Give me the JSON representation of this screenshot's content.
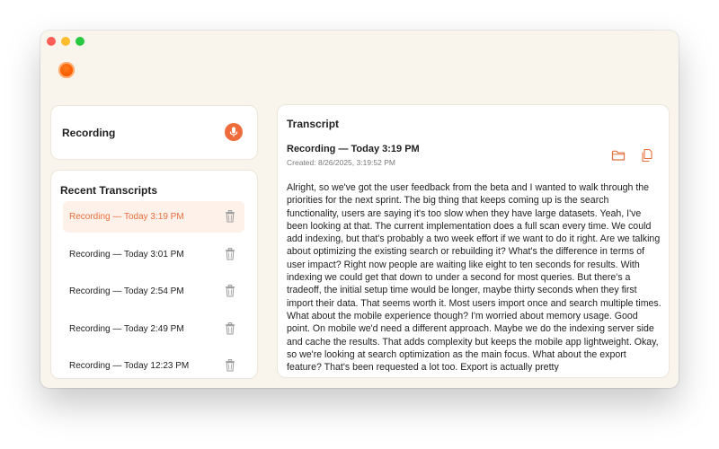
{
  "sidebar": {
    "recording_label": "Recording",
    "recent_title": "Recent Transcripts",
    "items": [
      {
        "label": "Recording — Today 3:19 PM",
        "active": true
      },
      {
        "label": "Recording — Today 3:01 PM",
        "active": false
      },
      {
        "label": "Recording — Today 2:54 PM",
        "active": false
      },
      {
        "label": "Recording — Today 2:49 PM",
        "active": false
      },
      {
        "label": "Recording — Today 12:23 PM",
        "active": false
      }
    ]
  },
  "transcript": {
    "header": "Transcript",
    "recording_title": "Recording — Today 3:19 PM",
    "created": "Created: 8/26/2025, 3:19:52 PM",
    "body": "Alright, so we've got the user feedback from the beta and I wanted to walk through the priorities for the next sprint. The big thing that keeps coming up is the search functionality, users are saying it's too slow when they have large datasets. Yeah, I've been looking at that. The current implementation does a full scan every time. We could add indexing, but that's probably a two week effort if we want to do it right. Are we talking about optimizing the existing search or rebuilding it? What's the difference in terms of user impact? Right now people are waiting like eight to ten seconds for results. With indexing we could get that down to under a second for most queries. But there's a tradeoff, the initial setup time would be longer, maybe thirty seconds when they first import their data. That seems worth it. Most users import once and search multiple times. What about the mobile experience though? I'm worried about memory usage. Good point. On mobile we'd need a different approach. Maybe we do the indexing server side and cache the results. That adds complexity but keeps the mobile app lightweight. Okay, so we're looking at search optimization as the main focus. What about the export feature? That's been requested a lot too. Export is actually pretty"
  },
  "icons": {
    "record": "microphone-icon",
    "delete": "trash-icon",
    "folder": "folder-icon",
    "copy": "copy-icon"
  },
  "colors": {
    "accent": "#e8703d",
    "window_bg": "#f9f4ec",
    "active_item_bg": "#fdf1ea"
  }
}
